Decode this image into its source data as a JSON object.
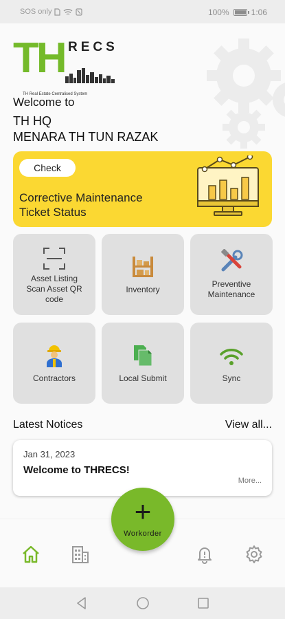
{
  "status_bar": {
    "left_text": "SOS only",
    "battery": "100%",
    "time": "1:06"
  },
  "logo": {
    "letters": "TH",
    "suffix": "RECS",
    "tagline": "TH Real Estate Centralised System"
  },
  "header": {
    "welcome": "Welcome to",
    "site_line1": "TH HQ",
    "site_line2": "MENARA TH TUN RAZAK"
  },
  "banner": {
    "check_label": "Check",
    "title_line1": "Corrective Maintenance",
    "title_line2": "Ticket Status"
  },
  "tiles": [
    {
      "label_line1": "Asset Listing",
      "label_line2": "Scan Asset QR",
      "label_line3": "code",
      "icon": "qr-scan-icon"
    },
    {
      "label_line1": "Inventory",
      "icon": "shelf-boxes-icon"
    },
    {
      "label_line1": "Preventive",
      "label_line2": "Maintenance",
      "icon": "tools-icon"
    },
    {
      "label_line1": "Contractors",
      "icon": "worker-icon"
    },
    {
      "label_line1": "Local Submit",
      "icon": "documents-icon"
    },
    {
      "label_line1": "Sync",
      "icon": "wifi-icon"
    }
  ],
  "notices": {
    "title": "Latest Notices",
    "view_all": "View all...",
    "items": [
      {
        "date": "Jan 31, 2023",
        "title": "Welcome to THRECS!",
        "more": "More..."
      }
    ]
  },
  "bottom_nav": {
    "fab_label": "Workorder",
    "items": [
      "home-icon",
      "building-icon",
      "bell-alert-icon",
      "gear-icon"
    ]
  },
  "colors": {
    "accent_green": "#79b92a",
    "banner_yellow": "#fbd832",
    "tile_gray": "#e0e0e0"
  }
}
